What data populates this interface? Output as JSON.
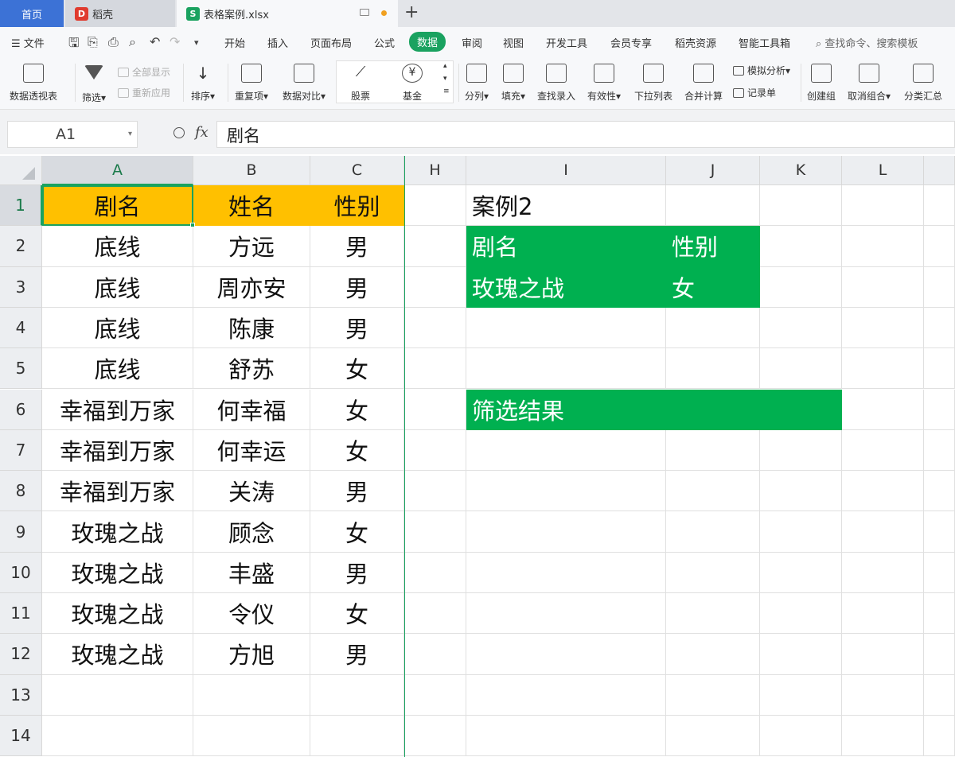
{
  "tabs": {
    "home": "首页",
    "docer": "稻壳",
    "file": "表格案例.xlsx"
  },
  "menu": {
    "file": "文件",
    "items": [
      "开始",
      "插入",
      "页面布局",
      "公式",
      "数据",
      "审阅",
      "视图",
      "开发工具",
      "会员专享",
      "稻壳资源",
      "智能工具箱"
    ],
    "active_index": 4,
    "search": "查找命令、搜索模板"
  },
  "ribbon": {
    "pivot": "数据透视表",
    "filter": "筛选",
    "show_all": "全部显示",
    "reapply": "重新应用",
    "sort": "排序",
    "duplicates": "重复项",
    "compare": "数据对比",
    "stock": "股票",
    "fund": "基金",
    "split": "分列",
    "fill": "填充",
    "lookup": "查找录入",
    "validity": "有效性",
    "dropdown": "下拉列表",
    "consolidate": "合并计算",
    "whatif": "模拟分析",
    "record": "记录单",
    "group": "创建组",
    "ungroup": "取消组合",
    "subtotal": "分类汇总"
  },
  "formula_bar": {
    "cell_ref": "A1",
    "fx": "fx",
    "content": "剧名"
  },
  "columns": [
    "A",
    "B",
    "C",
    "H",
    "I",
    "J",
    "K",
    "L"
  ],
  "rows": [
    "1",
    "2",
    "3",
    "4",
    "5",
    "6",
    "7",
    "8",
    "9",
    "10",
    "11",
    "12",
    "13",
    "14"
  ],
  "table": {
    "headers": [
      "剧名",
      "姓名",
      "性别"
    ],
    "rows": [
      [
        "底线",
        "方远",
        "男"
      ],
      [
        "底线",
        "周亦安",
        "男"
      ],
      [
        "底线",
        "陈康",
        "男"
      ],
      [
        "底线",
        "舒苏",
        "女"
      ],
      [
        "幸福到万家",
        "何幸福",
        "女"
      ],
      [
        "幸福到万家",
        "何幸运",
        "女"
      ],
      [
        "幸福到万家",
        "关涛",
        "男"
      ],
      [
        "玫瑰之战",
        "顾念",
        "女"
      ],
      [
        "玫瑰之战",
        "丰盛",
        "男"
      ],
      [
        "玫瑰之战",
        "令仪",
        "女"
      ],
      [
        "玫瑰之战",
        "方旭",
        "男"
      ]
    ]
  },
  "criteria": {
    "title": "案例2",
    "h1": "剧名",
    "h2": "性别",
    "v1": "玫瑰之战",
    "v2": "女",
    "result_label": "筛选结果"
  },
  "colors": {
    "accent": "#1aa260",
    "header_fill": "#ffc000",
    "criteria_fill": "#00b050"
  }
}
